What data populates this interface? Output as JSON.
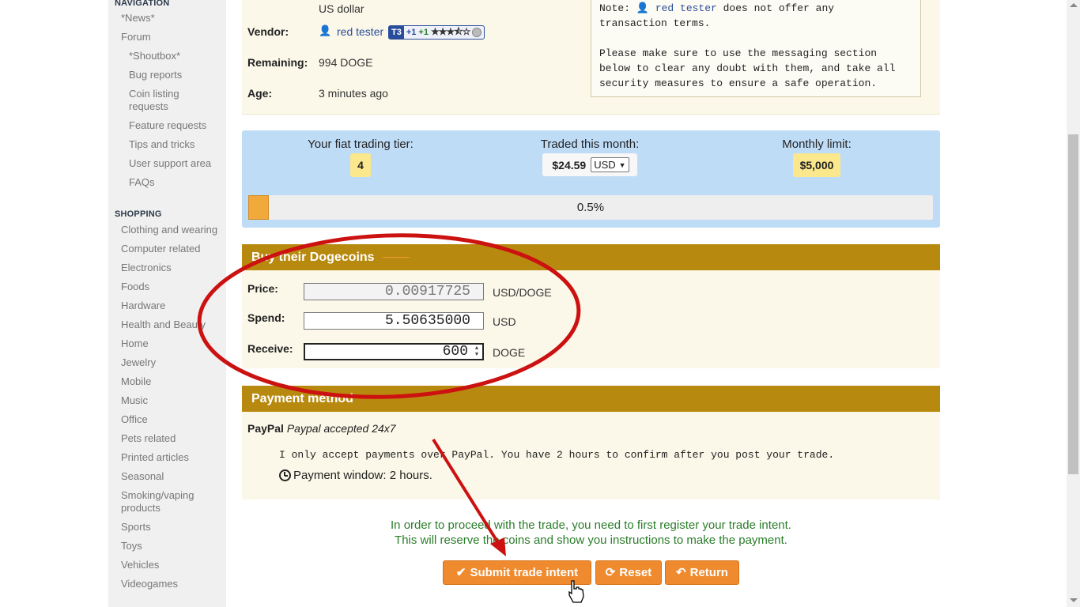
{
  "sidebar": {
    "navigation_heading": "NAVIGATION",
    "nav_items": [
      "*News*",
      "Forum",
      "*Shoutbox*",
      "Bug reports",
      "Coin listing requests",
      "Feature requests",
      "Tips and tricks",
      "User support area",
      "FAQs"
    ],
    "shopping_heading": "SHOPPING",
    "shop_items": [
      "Clothing and wearing",
      "Computer related",
      "Electronics",
      "Foods",
      "Hardware",
      "Health and Beauty",
      "Home",
      "Jewelry",
      "Mobile",
      "Music",
      "Office",
      "Pets related",
      "Printed articles",
      "Seasonal",
      "Smoking/vaping products",
      "Sports",
      "Toys",
      "Vehicles",
      "Videogames"
    ]
  },
  "vendor_info": {
    "currency_value": "US dollar",
    "vendor_label": "Vendor:",
    "vendor_name": "red tester",
    "badge_tier": "T3",
    "badge_pos1": "+1",
    "badge_pos2": "+1",
    "badge_stars": "★★★⯪☆",
    "remaining_label": "Remaining:",
    "remaining_value": "994 DOGE",
    "age_label": "Age:",
    "age_value": "3 minutes ago",
    "note_prefix": "Note: ",
    "note_name": "red tester",
    "note_line1_rest": " does not offer any",
    "note_line2": "transaction terms.",
    "note_para2_line1": "Please make sure to use the messaging section",
    "note_para2_line2": "below to clear any doubt with them, and take all",
    "note_para2_line3": "security measures to ensure a safe operation."
  },
  "tier": {
    "tier_label": "Your fiat trading tier:",
    "tier_value": "4",
    "traded_label": "Traded this month:",
    "traded_value": "$24.59",
    "traded_currency": "USD",
    "limit_label": "Monthly limit:",
    "limit_value": "$5,000",
    "progress_text": "0.5%",
    "progress_fraction": 0.03
  },
  "buy": {
    "heading": "Buy their Dogecoins",
    "price_label": "Price:",
    "price_value": "0.00917725",
    "price_unit": "USD/DOGE",
    "spend_label": "Spend:",
    "spend_value": "5.50635000",
    "spend_unit": "USD",
    "receive_label": "Receive:",
    "receive_value": "600",
    "receive_unit": "DOGE"
  },
  "payment": {
    "heading": "Payment method",
    "method_name": "PayPal",
    "method_desc": "Paypal accepted 24x7",
    "terms": "I only accept payments over PayPal. You have 2 hours to confirm after you post your trade.",
    "window_text": "Payment window: 2 hours."
  },
  "actions": {
    "info_line1": "In order to proceed with the trade, you need to first register your trade intent.",
    "info_line2": "This will reserve the coins and show you instructions to make the payment.",
    "submit_label": "Submit trade intent",
    "reset_label": "Reset",
    "return_label": "Return"
  },
  "colors": {
    "section_header": "#b8890f",
    "panel_bg": "#fbf8e9",
    "tier_bg": "#bfdcf7",
    "button": "#ef8a2e",
    "annotation_red": "#cc1111",
    "info_green": "#2a7d2a"
  }
}
